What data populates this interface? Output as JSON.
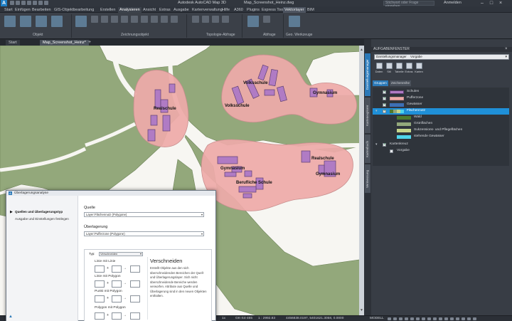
{
  "titlebar": {
    "app_title": "Autodesk AutoCAD Map 3D",
    "file_title": "Map_Screenshot_Heinz.dwg",
    "search_placeholder": "Stichwort oder Frage eingeben",
    "user": "Anmelden",
    "logo": "A"
  },
  "ribbon_tabs": [
    "Start",
    "Einfügen",
    "Bearbeiten",
    "GIS-Objektbearbeitung",
    "Erstellen",
    "Analysieren",
    "Ansicht",
    "Extras",
    "Ausgabe",
    "Kartenverwaltung",
    "Hilfe",
    "A360",
    "Plugins",
    "Express Tools",
    "Vektorlayer",
    "BIM"
  ],
  "ribbon_active_tab": "Analysieren",
  "ribbon_groups": [
    "Objekt",
    "Zeichnungsobjekt",
    "Topologie-Abfrage",
    "Abfrage",
    "Geo. Werkzeuge"
  ],
  "doc_tabs": [
    "Start",
    "Map_Screenshot_Heinz*"
  ],
  "doc_add": "+",
  "map": {
    "labels": [
      "Volksschule",
      "Gymnasium",
      "Realschule",
      "Volksschule",
      "Gymnasium",
      "Realschule",
      "Berufliche Schule",
      "Gymnasium"
    ],
    "colors": {
      "background": "#f7f6f2",
      "green": "#93a87b",
      "buffer": "#eeaaa9",
      "buffer_stroke": "#c98e8e",
      "school": "#b07bc4",
      "school_stroke": "#5f3f72",
      "road": "#f7f6f2"
    }
  },
  "palette": {
    "title": "AUFGABENFENSTER",
    "select_value": "Darstellungsmanager",
    "select_value_secondary": "Vorgabe",
    "tools": [
      "Daten",
      "Stil",
      "Tabelle",
      "Extras",
      "Karten"
    ],
    "subtabs": [
      "Gruppen",
      "Zeichenreihe"
    ],
    "side_tabs": [
      "Darstellungsmanager",
      "Kartenexplorer",
      "Kartenbuch",
      "Vermessung"
    ],
    "layers": [
      {
        "name": "Schulen",
        "color": "#b07bc4",
        "checked": true
      },
      {
        "name": "Pufferzone",
        "color": "#eeaaa9",
        "checked": true
      },
      {
        "name": "Gewässer",
        "color": "#3d6fb5",
        "checked": true
      },
      {
        "name": "Flächennutz",
        "color": "#556b2f",
        "checked": true,
        "selected": true
      },
      {
        "name": "Wald",
        "color": "#4e7a2d"
      },
      {
        "name": "Grünflächen",
        "color": "#93a87b"
      },
      {
        "name": "Sukzessions- und Pflegeflächen",
        "color": "#c6d68b"
      },
      {
        "name": "stehende Gewässer",
        "color": "#4fd5ea"
      },
      {
        "name": "Kartenkreuz",
        "checked": true
      },
      {
        "name": "Vorgabe",
        "checked": false
      }
    ]
  },
  "statusbar": {
    "coords": "4456838.0197, 5401621.3058, 0.0000",
    "model": "MODELL",
    "map_scale": "1 : 2992.83",
    "crs": "GK-S4-465",
    "scale": "1x"
  },
  "dialog": {
    "title": "Überlagerungsanalyse",
    "steps": [
      "Quellen und Überlagerungstyp",
      "Ausgabe und Einstellungen festlegen"
    ],
    "source_label": "Quelle",
    "source_value": "Layer:Flächennutz (Polygone)",
    "overlay_label": "Überlagerung",
    "overlay_value": "Layer:Pufferzone (Polygone)",
    "type_label": "Typ:",
    "type_value": "Verschneiden",
    "options": [
      "Linie mit Linie",
      "Linie mit Polygon",
      "Punkt mit Polygon",
      "Polygon mit Polygon"
    ],
    "description_title": "Verschneiden",
    "description": "Erstellt Objekte aus den sich überschneidenden Bereichen der Quell- und Überlagerungslayer. Sich nicht überschneidende Bereiche werden verworfen. Attribute aus Quelle und Überlagerung sind in den neuen Objekten enthalten."
  }
}
